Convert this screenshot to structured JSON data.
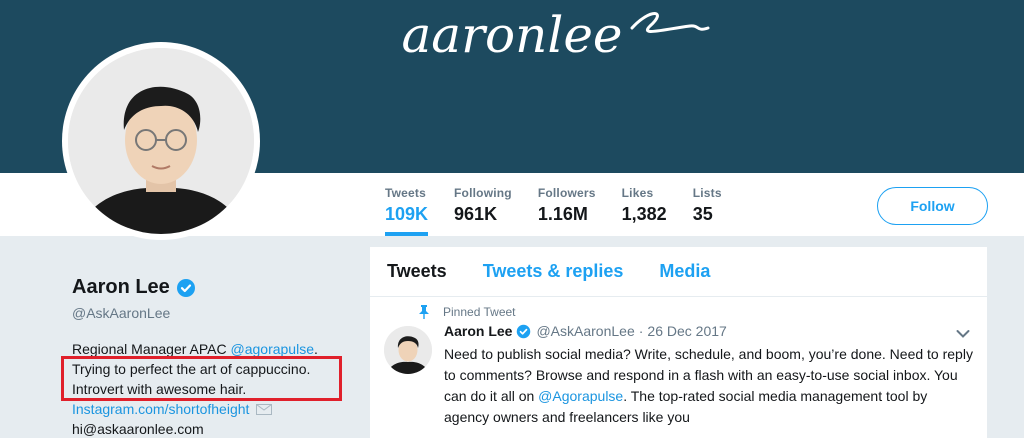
{
  "banner": {
    "logo_text": "aaronlee"
  },
  "stats": [
    {
      "label": "Tweets",
      "value": "109K",
      "active": true
    },
    {
      "label": "Following",
      "value": "961K"
    },
    {
      "label": "Followers",
      "value": "1.16M"
    },
    {
      "label": "Likes",
      "value": "1,382"
    },
    {
      "label": "Lists",
      "value": "35"
    }
  ],
  "follow_label": "Follow",
  "profile": {
    "name": "Aaron Lee",
    "handle": "@AskAaronLee",
    "bio_line1_prefix": "Regional Manager APAC ",
    "bio_line1_mention": "@agorapulse",
    "bio_line1_suffix": ".",
    "bio_line2": "Trying to perfect the art of cappuccino.",
    "bio_line3": "Introvert with awesome hair.",
    "link": "Instagram.com/shortofheight",
    "email": "hi@askaaronlee.com"
  },
  "tabs": [
    {
      "label": "Tweets",
      "active": true
    },
    {
      "label": "Tweets & replies"
    },
    {
      "label": "Media"
    }
  ],
  "tweet": {
    "pinned_label": "Pinned Tweet",
    "name": "Aaron Lee",
    "handle": "@AskAaronLee",
    "dot": "·",
    "date": "26 Dec 2017",
    "text_part1": "Need to publish social media? Write, schedule, and boom, you’re done. Need to reply to comments? Browse and respond in a flash with an easy-to-use social inbox. You can do it all on ",
    "text_mention": "@Agorapulse",
    "text_part2": ". The top-rated social media management tool by agency owners and freelancers like you"
  },
  "colors": {
    "banner": "#1d4a5f",
    "accent": "#1da1f2",
    "highlight": "#e0202b",
    "page_bg": "#e6ecf0"
  }
}
